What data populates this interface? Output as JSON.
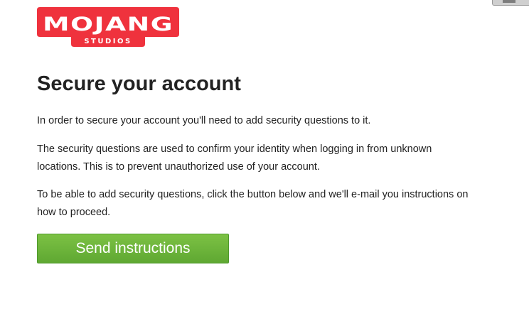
{
  "logo": {
    "wordmark": "MOJANG",
    "subtitle": "STUDIOS",
    "color": "#EF323D"
  },
  "main": {
    "title": "Secure your account",
    "paragraphs": [
      "In order to secure your account you'll need to add security questions to it.",
      "The security questions are used to confirm your identity when logging in from unknown locations. This is to prevent unauthorized use of your account.",
      "To be able to add security questions, click the button below and we'll e-mail you instructions on how to proceed."
    ],
    "button_label": "Send instructions",
    "button_color": "#6AB43A"
  }
}
